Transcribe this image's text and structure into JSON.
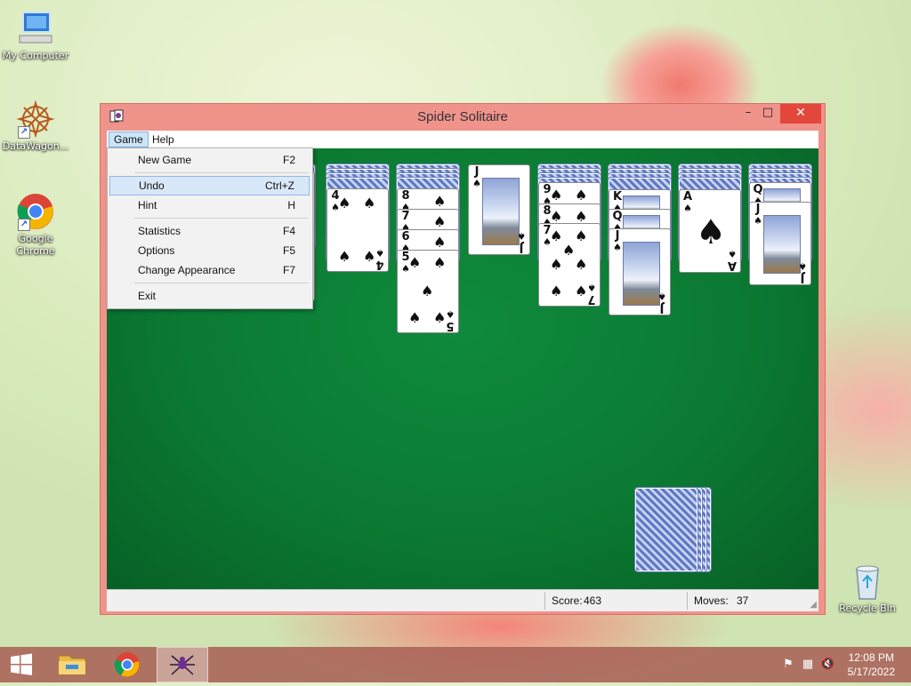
{
  "desktop": {
    "icons": [
      {
        "label": "My Computer"
      },
      {
        "label": "DataWagon..."
      },
      {
        "label": "Google Chrome"
      },
      {
        "label": "Recycle Bin"
      }
    ]
  },
  "window": {
    "title": "Spider Solitaire",
    "controls": {
      "minimize": "–",
      "maximize": "□",
      "close": "✕"
    },
    "menu": {
      "game": "Game",
      "help": "Help"
    }
  },
  "game_menu": {
    "items": [
      {
        "label": "New Game",
        "shortcut": "F2"
      },
      {
        "label": "Undo",
        "shortcut": "Ctrl+Z"
      },
      {
        "label": "Hint",
        "shortcut": "H"
      },
      {
        "label": "Statistics",
        "shortcut": "F4"
      },
      {
        "label": "Options",
        "shortcut": "F5"
      },
      {
        "label": "Change Appearance",
        "shortcut": "F7"
      },
      {
        "label": "Exit",
        "shortcut": ""
      }
    ],
    "highlighted": "Undo"
  },
  "status": {
    "score_label": "Score:",
    "score": "463",
    "moves_label": "Moves:",
    "moves": "37"
  },
  "cards": {
    "suit": "♠",
    "col2_top": "4",
    "col2_partial": "4",
    "col3": [
      "8",
      "7",
      "6",
      "5"
    ],
    "col4_top": "J",
    "col5": [
      "9",
      "8",
      "7"
    ],
    "col6": [
      "K",
      "Q",
      "J"
    ],
    "col7_top": "A",
    "col8": [
      "Q",
      "J"
    ]
  },
  "taskbar": {
    "time": "12:08 PM",
    "date": "5/17/2022"
  },
  "colors": {
    "table_green": "#0b7a33",
    "window_frame": "#f0938b",
    "close_red": "#e3463a",
    "menu_highlight": "#d9e8f8"
  }
}
